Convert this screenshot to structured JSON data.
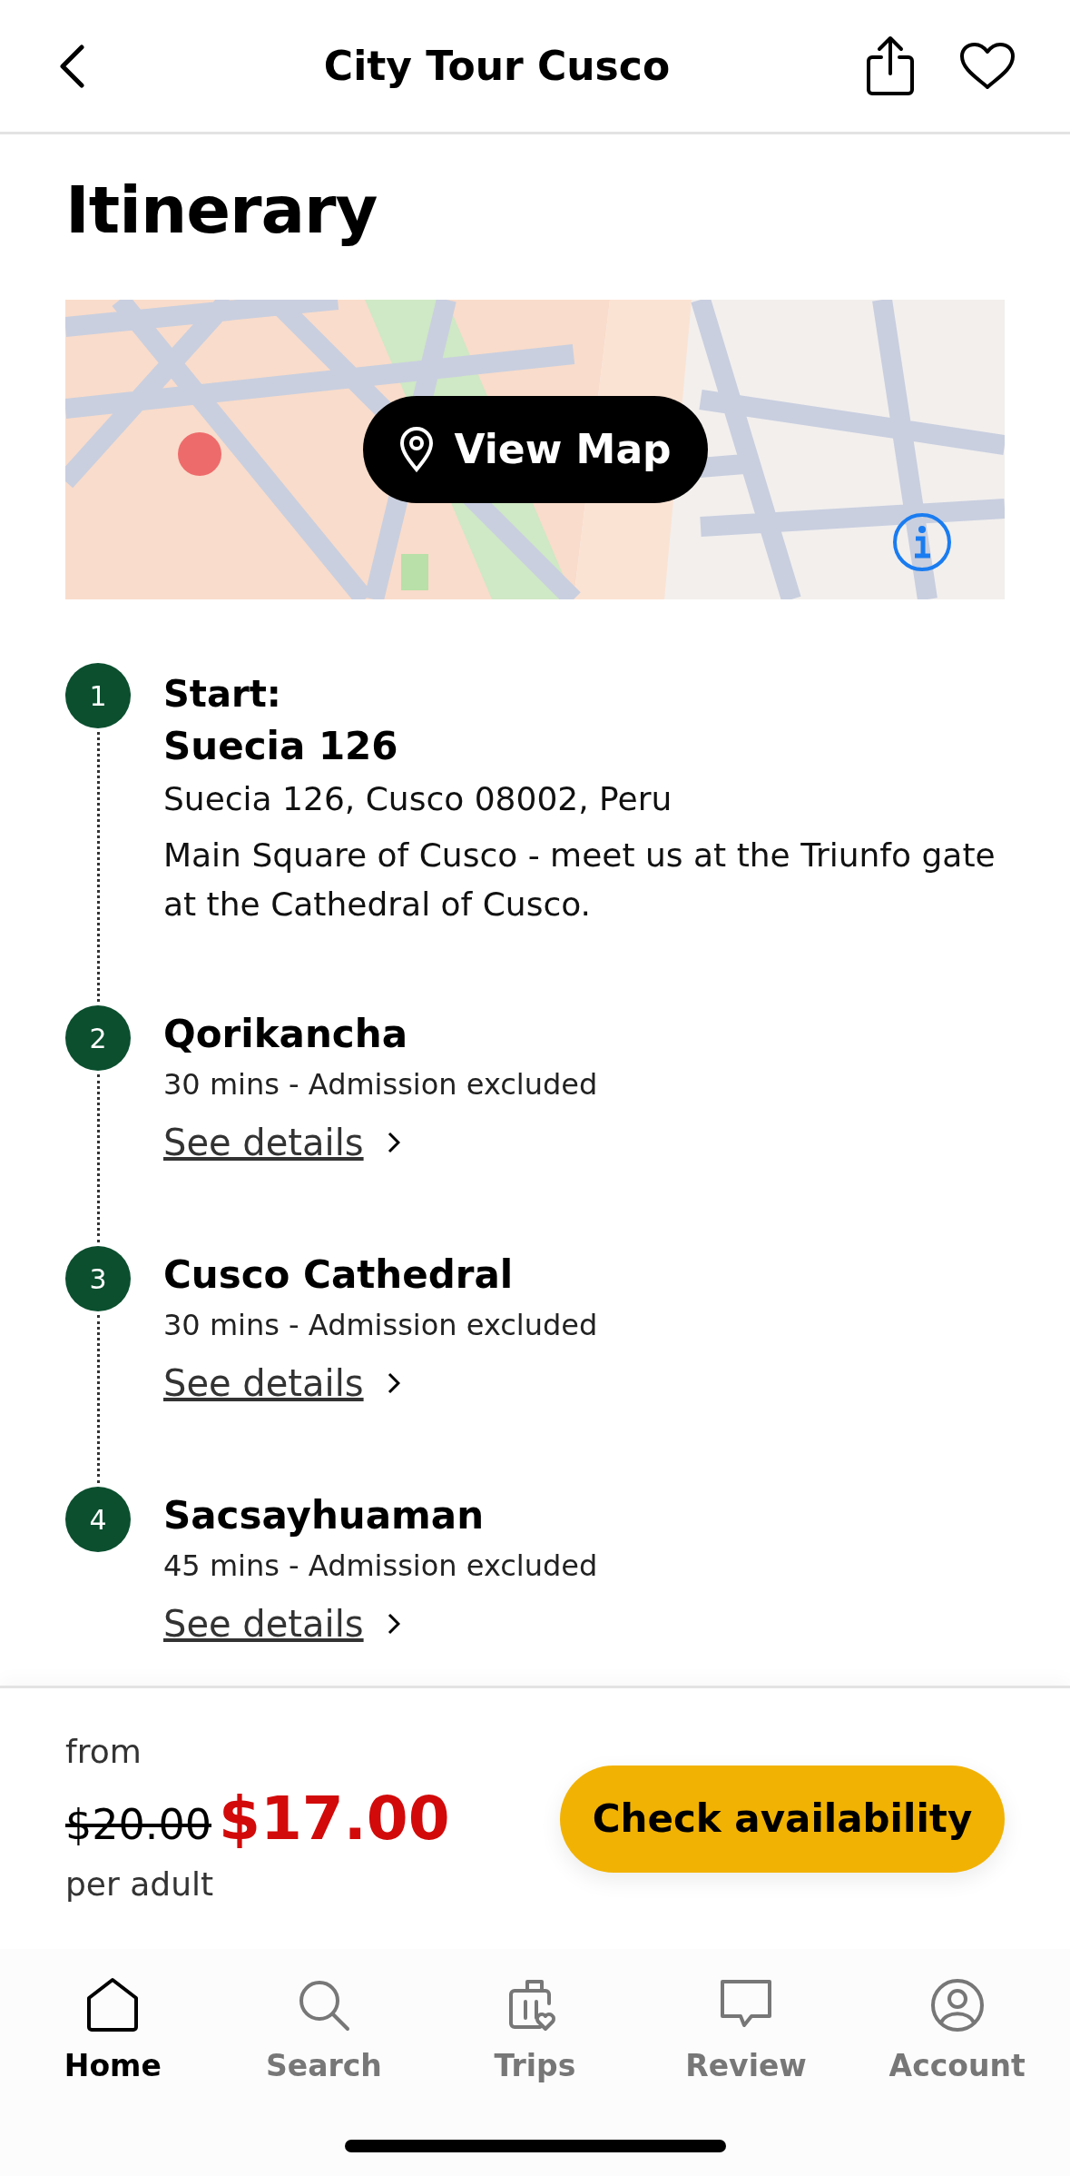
{
  "header": {
    "title": "City Tour Cusco"
  },
  "section_title": "Itinerary",
  "map": {
    "kind": "picture",
    "button": "View Map"
  },
  "stops": [
    {
      "number": "1",
      "label": "Start:",
      "title": "Suecia 126",
      "address": "Suecia 126, Cusco 08002, Peru",
      "description": "Main Square of Cusco - meet us at the Triunfo gate at the Cathedral of Cusco."
    },
    {
      "number": "2",
      "title": "Qorikancha",
      "meta": "30 mins - Admission excluded",
      "link": "See details"
    },
    {
      "number": "3",
      "title": "Cusco Cathedral",
      "meta": "30 mins - Admission excluded",
      "link": "See details"
    },
    {
      "number": "4",
      "title": "Sacsayhuaman",
      "meta": "45 mins - Admission excluded",
      "link": "See details"
    }
  ],
  "booking": {
    "from": "from",
    "old_price": "$20.00",
    "price": "$17.00",
    "unit": "per adult",
    "button": "Check availability"
  },
  "nav": [
    {
      "label": "Home",
      "kind": "home",
      "selected": true
    },
    {
      "label": "Search",
      "kind": "search",
      "selected": false
    },
    {
      "label": "Trips",
      "kind": "trips",
      "selected": false
    },
    {
      "label": "Review",
      "kind": "review",
      "selected": false
    },
    {
      "label": "Account",
      "kind": "account",
      "selected": false
    }
  ]
}
